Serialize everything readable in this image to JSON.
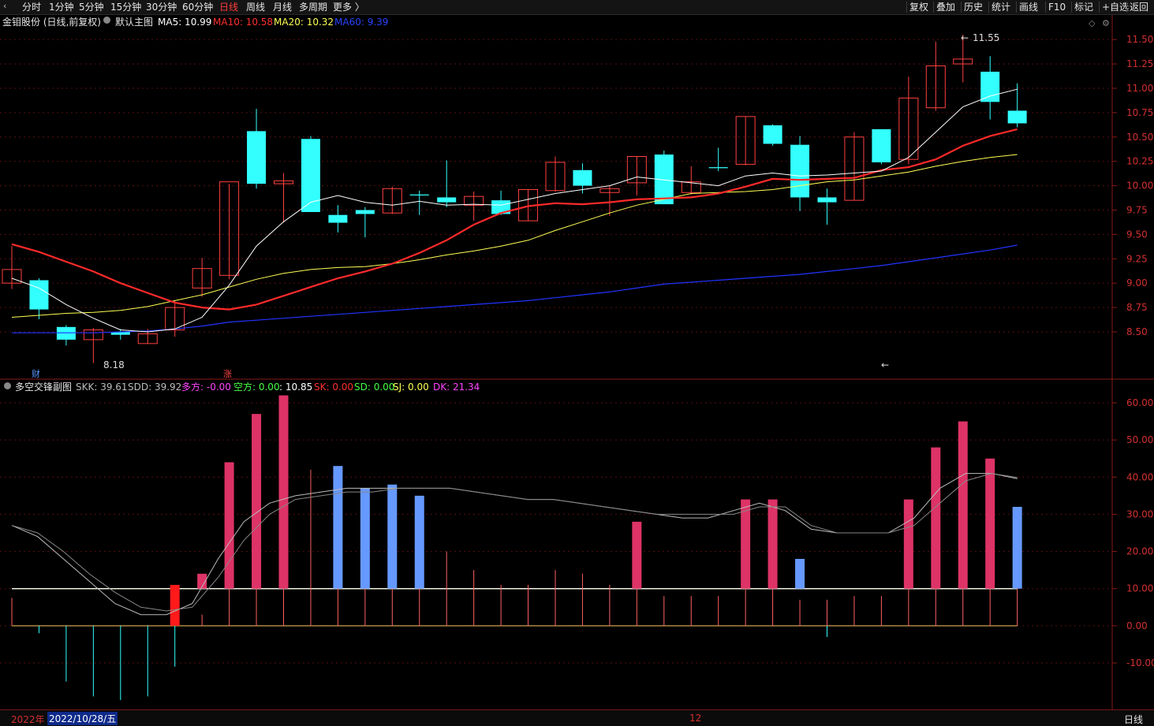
{
  "toolbar": {
    "back_arrow": "‹",
    "periods": [
      "分时",
      "1分钟",
      "5分钟",
      "15分钟",
      "30分钟",
      "60分钟",
      "日线",
      "周线",
      "月线",
      "多周期",
      "更多 〉"
    ],
    "active_period": "日线",
    "right_buttons": [
      "复权",
      "叠加",
      "历史",
      "统计",
      "画线",
      "F10",
      "标记",
      "+自选",
      "返回"
    ]
  },
  "main_header": {
    "stock_title": "金钼股份 (日线,前复权)",
    "chart_name": "默认主图",
    "ma5": "MA5: 10.99",
    "ma10": "MA10: 10.58",
    "ma20": "MA20: 10.32",
    "ma60": "MA60: 9.39"
  },
  "sub_header": {
    "chart_name": "多空交锋副图",
    "skk": "SKK: 39.61",
    "sdd": "SDD: 39.92",
    "duofang": "多方: -0.00",
    "kongfang": "空方: 0.00",
    "value": ": 10.85",
    "sk": "SK: 0.00",
    "sd": "SD: 0.00",
    "sj": "SJ: 0.00",
    "dk": "DK: 21.34"
  },
  "annotations": {
    "high_label": "11.55",
    "low_label": "8.18",
    "fin_marker": "财",
    "zhang_marker": "涨"
  },
  "colors": {
    "ma5": "#ffffff",
    "ma10": "#ff2a2a",
    "ma20": "#ffff55",
    "ma60": "#2233ff",
    "up": "#ff4040",
    "down": "#33ffff",
    "bar_pink": "#dd3366",
    "bar_blue": "#6699ff"
  },
  "footer": {
    "year": "2022年",
    "date": "2022/10/28/五",
    "month_marker": "12",
    "period": "日线"
  },
  "chart_data": [
    {
      "type": "candlestick",
      "y_ticks": [
        "11.50",
        "11.25",
        "11.00",
        "10.75",
        "10.50",
        "10.25",
        "10.00",
        "9.75",
        "9.50",
        "9.25",
        "9.00",
        "8.75",
        "8.50"
      ],
      "candles": [
        {
          "o": 9.0,
          "h": 9.38,
          "l": 8.94,
          "c": 9.14
        },
        {
          "o": 9.03,
          "h": 9.05,
          "l": 8.63,
          "c": 8.73
        },
        {
          "o": 8.55,
          "h": 8.57,
          "l": 8.36,
          "c": 8.42
        },
        {
          "o": 8.42,
          "h": 8.54,
          "l": 8.18,
          "c": 8.52
        },
        {
          "o": 8.5,
          "h": 8.53,
          "l": 8.42,
          "c": 8.47
        },
        {
          "o": 8.38,
          "h": 8.53,
          "l": 8.38,
          "c": 8.48
        },
        {
          "o": 8.52,
          "h": 8.82,
          "l": 8.45,
          "c": 8.75
        },
        {
          "o": 8.95,
          "h": 9.26,
          "l": 8.86,
          "c": 9.15
        },
        {
          "o": 9.08,
          "h": 10.02,
          "l": 9.04,
          "c": 10.04
        },
        {
          "o": 10.56,
          "h": 10.79,
          "l": 9.97,
          "c": 10.02
        },
        {
          "o": 10.02,
          "h": 10.13,
          "l": 9.62,
          "c": 10.05
        },
        {
          "o": 10.48,
          "h": 10.51,
          "l": 9.73,
          "c": 9.73
        },
        {
          "o": 9.7,
          "h": 9.8,
          "l": 9.52,
          "c": 9.62
        },
        {
          "o": 9.75,
          "h": 9.78,
          "l": 9.47,
          "c": 9.71
        },
        {
          "o": 9.72,
          "h": 9.99,
          "l": 9.71,
          "c": 9.97
        },
        {
          "o": 9.91,
          "h": 9.95,
          "l": 9.7,
          "c": 9.9
        },
        {
          "o": 9.88,
          "h": 10.26,
          "l": 9.78,
          "c": 9.83
        },
        {
          "o": 9.8,
          "h": 9.94,
          "l": 9.64,
          "c": 9.89
        },
        {
          "o": 9.85,
          "h": 9.95,
          "l": 9.7,
          "c": 9.71
        },
        {
          "o": 9.64,
          "h": 9.96,
          "l": 9.64,
          "c": 9.96
        },
        {
          "o": 9.95,
          "h": 10.3,
          "l": 9.94,
          "c": 10.24
        },
        {
          "o": 10.16,
          "h": 10.23,
          "l": 9.92,
          "c": 10.0
        },
        {
          "o": 9.93,
          "h": 10.0,
          "l": 9.69,
          "c": 9.97
        },
        {
          "o": 10.03,
          "h": 10.3,
          "l": 9.9,
          "c": 10.3
        },
        {
          "o": 10.32,
          "h": 10.36,
          "l": 9.81,
          "c": 9.81
        },
        {
          "o": 9.93,
          "h": 10.2,
          "l": 9.91,
          "c": 10.04
        },
        {
          "o": 10.19,
          "h": 10.39,
          "l": 10.15,
          "c": 10.18
        },
        {
          "o": 10.22,
          "h": 10.71,
          "l": 10.21,
          "c": 10.71
        },
        {
          "o": 10.62,
          "h": 10.63,
          "l": 10.41,
          "c": 10.43
        },
        {
          "o": 10.42,
          "h": 10.51,
          "l": 9.74,
          "c": 9.88
        },
        {
          "o": 9.88,
          "h": 9.97,
          "l": 9.6,
          "c": 9.83
        },
        {
          "o": 9.85,
          "h": 10.55,
          "l": 9.85,
          "c": 10.5
        },
        {
          "o": 10.58,
          "h": 10.58,
          "l": 10.22,
          "c": 10.24
        },
        {
          "o": 10.27,
          "h": 11.12,
          "l": 10.22,
          "c": 10.9
        },
        {
          "o": 10.8,
          "h": 11.48,
          "l": 10.77,
          "c": 11.23
        },
        {
          "o": 11.25,
          "h": 11.55,
          "l": 11.06,
          "c": 11.3
        },
        {
          "o": 11.17,
          "h": 11.33,
          "l": 10.68,
          "c": 10.86
        },
        {
          "o": 10.77,
          "h": 11.05,
          "l": 10.6,
          "c": 10.64
        }
      ],
      "ma5": [
        9.05,
        8.95,
        8.78,
        8.64,
        8.52,
        8.5,
        8.53,
        8.65,
        8.98,
        9.38,
        9.63,
        9.83,
        9.9,
        9.83,
        9.8,
        9.84,
        9.8,
        9.81,
        9.8,
        9.86,
        9.92,
        9.96,
        10.0,
        10.09,
        10.06,
        10.03,
        10.0,
        10.1,
        10.13,
        10.1,
        10.11,
        10.13,
        10.15,
        10.29,
        10.55,
        10.81,
        10.92,
        10.99
      ],
      "ma10": [
        9.4,
        9.32,
        9.22,
        9.12,
        9.0,
        8.9,
        8.8,
        8.75,
        8.73,
        8.78,
        8.87,
        8.96,
        9.05,
        9.12,
        9.2,
        9.31,
        9.44,
        9.6,
        9.72,
        9.79,
        9.82,
        9.81,
        9.83,
        9.86,
        9.87,
        9.88,
        9.92,
        9.99,
        10.07,
        10.06,
        10.07,
        10.08,
        10.16,
        10.19,
        10.27,
        10.41,
        10.51,
        10.58
      ],
      "ma20": [
        8.65,
        8.67,
        8.69,
        8.7,
        8.72,
        8.76,
        8.82,
        8.88,
        8.96,
        9.04,
        9.1,
        9.14,
        9.16,
        9.17,
        9.2,
        9.24,
        9.29,
        9.33,
        9.38,
        9.44,
        9.54,
        9.63,
        9.72,
        9.8,
        9.86,
        9.92,
        9.93,
        9.94,
        9.96,
        10.0,
        10.04,
        10.06,
        10.1,
        10.14,
        10.2,
        10.25,
        10.29,
        10.32
      ],
      "ma60": [
        8.49,
        8.49,
        8.49,
        8.49,
        8.5,
        8.51,
        8.53,
        8.56,
        8.6,
        8.62,
        8.64,
        8.66,
        8.68,
        8.7,
        8.72,
        8.74,
        8.76,
        8.78,
        8.8,
        8.82,
        8.85,
        8.88,
        8.91,
        8.95,
        8.99,
        9.01,
        9.03,
        9.05,
        9.07,
        9.09,
        9.12,
        9.15,
        9.18,
        9.22,
        9.26,
        9.3,
        9.34,
        9.39
      ]
    },
    {
      "type": "bar",
      "y_ticks": [
        "60.00",
        "50.00",
        "40.00",
        "30.00",
        "20.00",
        "10.00",
        "0.00",
        "-10.00"
      ],
      "values": [
        7.5,
        -2,
        -15,
        -19,
        -20,
        -19,
        -13,
        11,
        3,
        14,
        44,
        57,
        62,
        42,
        11,
        43,
        11,
        37,
        11,
        38,
        35,
        20,
        15,
        13,
        13,
        11,
        15,
        14,
        7,
        28,
        8,
        8,
        8,
        8,
        34,
        34,
        7,
        18,
        7,
        -3,
        8,
        8,
        34,
        48,
        55,
        45,
        10,
        32
      ],
      "colored_bars": [
        {
          "i": 6,
          "v": 11,
          "c": "red"
        },
        {
          "i": 7,
          "v": 14,
          "c": "pink"
        },
        {
          "i": 8,
          "v": 44,
          "c": "pink"
        },
        {
          "i": 9,
          "v": 57,
          "c": "pink"
        },
        {
          "i": 10,
          "v": 62,
          "c": "pink"
        },
        {
          "i": 12,
          "v": 43,
          "c": "blue"
        },
        {
          "i": 13,
          "v": 37,
          "c": "blue"
        },
        {
          "i": 14,
          "v": 38,
          "c": "blue"
        },
        {
          "i": 15,
          "v": 35,
          "c": "blue"
        },
        {
          "i": 23,
          "v": 28,
          "c": "pink"
        },
        {
          "i": 27,
          "v": 34,
          "c": "pink"
        },
        {
          "i": 28,
          "v": 34,
          "c": "pink"
        },
        {
          "i": 29,
          "v": 18,
          "c": "blue"
        },
        {
          "i": 33,
          "v": 34,
          "c": "pink"
        },
        {
          "i": 34,
          "v": 48,
          "c": "pink"
        },
        {
          "i": 35,
          "v": 55,
          "c": "pink"
        },
        {
          "i": 36,
          "v": 45,
          "c": "pink"
        },
        {
          "i": 37,
          "v": 32,
          "c": "blue"
        }
      ],
      "thin_lines": [
        {
          "i": 0,
          "v": 7.5
        },
        {
          "i": 1,
          "v": -2
        },
        {
          "i": 2,
          "v": -15
        },
        {
          "i": 3,
          "v": -19
        },
        {
          "i": 4,
          "v": -20
        },
        {
          "i": 5,
          "v": -19
        },
        {
          "i": 6,
          "v": -11
        },
        {
          "i": 7,
          "v": 3
        },
        {
          "i": 8,
          "v": 11
        },
        {
          "i": 9,
          "v": 11
        },
        {
          "i": 10,
          "v": 11
        },
        {
          "i": 11,
          "v": 42
        },
        {
          "i": 12,
          "v": 11
        },
        {
          "i": 13,
          "v": 11
        },
        {
          "i": 14,
          "v": 11
        },
        {
          "i": 15,
          "v": 11
        },
        {
          "i": 16,
          "v": 20
        },
        {
          "i": 17,
          "v": 15
        },
        {
          "i": 18,
          "v": 11
        },
        {
          "i": 19,
          "v": 11
        },
        {
          "i": 20,
          "v": 15
        },
        {
          "i": 21,
          "v": 14
        },
        {
          "i": 22,
          "v": 11
        },
        {
          "i": 23,
          "v": 11
        },
        {
          "i": 24,
          "v": 8
        },
        {
          "i": 25,
          "v": 8
        },
        {
          "i": 26,
          "v": 8
        },
        {
          "i": 27,
          "v": 11
        },
        {
          "i": 28,
          "v": 11
        },
        {
          "i": 29,
          "v": 7
        },
        {
          "i": 30,
          "v": 7
        },
        {
          "i": 30,
          "v": -3
        },
        {
          "i": 31,
          "v": 8
        },
        {
          "i": 32,
          "v": 8
        },
        {
          "i": 33,
          "v": 11
        },
        {
          "i": 34,
          "v": 11
        },
        {
          "i": 35,
          "v": 11
        },
        {
          "i": 36,
          "v": 11
        },
        {
          "i": 37,
          "v": 11
        }
      ],
      "skk": [
        27,
        24,
        18,
        12,
        6,
        3,
        3,
        6,
        18,
        28,
        33,
        35,
        36,
        37,
        37,
        37,
        37,
        37,
        36,
        35,
        34,
        34,
        33,
        32,
        31,
        30,
        29,
        29,
        31,
        33,
        31,
        26,
        25,
        25,
        25,
        29,
        37,
        41,
        41,
        39.6
      ],
      "sdd": [
        27,
        25,
        20,
        14,
        9,
        5,
        4,
        5,
        13,
        23,
        30,
        34,
        35,
        36,
        36,
        37,
        37,
        37,
        36,
        35,
        34,
        34,
        33,
        32,
        31,
        30,
        30,
        30,
        30,
        32,
        32,
        27,
        25,
        25,
        25,
        27,
        33,
        39,
        41,
        39.9
      ]
    }
  ]
}
